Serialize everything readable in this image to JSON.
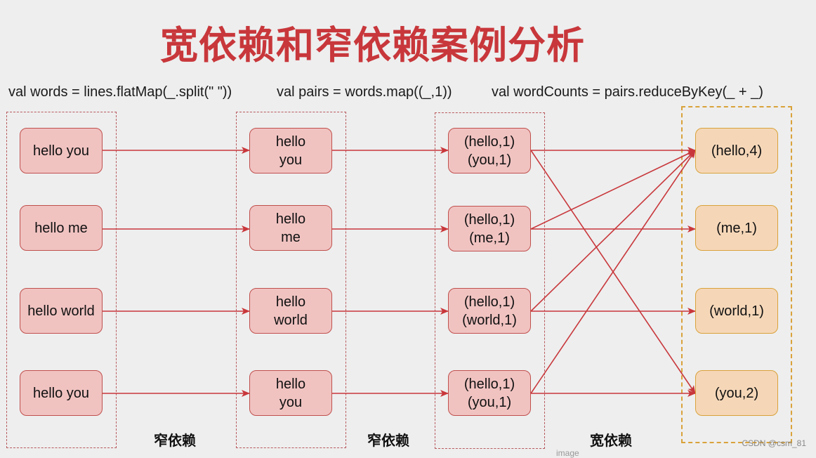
{
  "title": "宽依赖和窄依赖案例分析",
  "code": {
    "words": "val words = lines.flatMap(_.split(\" \"))",
    "pairs": "val pairs = words.map((_,1))",
    "wordCounts": "val wordCounts = pairs.reduceByKey(_ + _)"
  },
  "columns": {
    "lines": [
      "hello you",
      "hello me",
      "hello world",
      "hello you"
    ],
    "words": [
      [
        "hello",
        "you"
      ],
      [
        "hello",
        "me"
      ],
      [
        "hello",
        "world"
      ],
      [
        "hello",
        "you"
      ]
    ],
    "pairs": [
      [
        "(hello,1)",
        "(you,1)"
      ],
      [
        "(hello,1)",
        "(me,1)"
      ],
      [
        "(hello,1)",
        "(world,1)"
      ],
      [
        "(hello,1)",
        "(you,1)"
      ]
    ],
    "counts": [
      "(hello,4)",
      "(me,1)",
      "(world,1)",
      "(you,2)"
    ]
  },
  "labels": {
    "narrow1": "窄依赖",
    "narrow2": "窄依赖",
    "wide": "宽依赖"
  },
  "edges": {
    "lines_to_words": [
      [
        0,
        0
      ],
      [
        1,
        1
      ],
      [
        2,
        2
      ],
      [
        3,
        3
      ]
    ],
    "words_to_pairs": [
      [
        0,
        0
      ],
      [
        1,
        1
      ],
      [
        2,
        2
      ],
      [
        3,
        3
      ]
    ],
    "pairs_to_counts": [
      [
        0,
        0
      ],
      [
        0,
        3
      ],
      [
        1,
        0
      ],
      [
        1,
        1
      ],
      [
        2,
        0
      ],
      [
        2,
        2
      ],
      [
        3,
        0
      ],
      [
        3,
        3
      ]
    ]
  },
  "colors": {
    "title": "#c8373b",
    "arrow": "#c8373b",
    "box_fill": "#f0c3c1",
    "box_border": "#c0504d",
    "result_fill": "#f5d7b8",
    "result_border": "#d9a23a"
  },
  "watermark": "CSDN @csm_81",
  "faint_caption": "image"
}
